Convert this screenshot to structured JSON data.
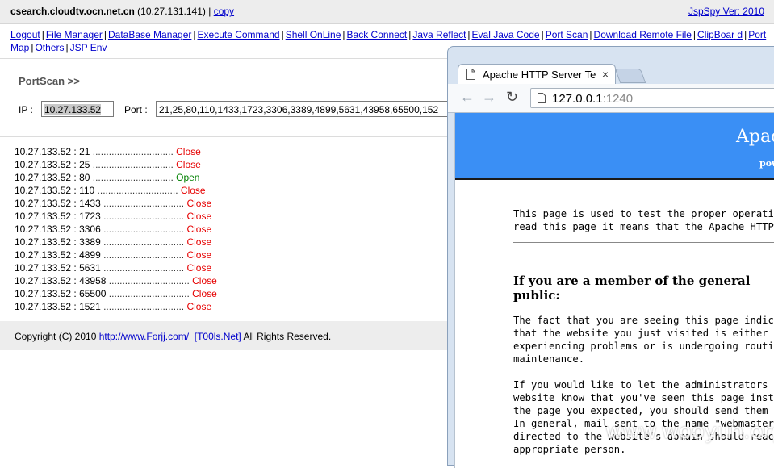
{
  "header": {
    "host_bold": "csearch.cloudtv.ocn.net.cn",
    "host_ip": " (10.27.131.141) | ",
    "copy_link": "copy",
    "version_link": "JspSpy Ver: 2010"
  },
  "menu": [
    "Logout",
    "File Manager",
    "DataBase Manager",
    "Execute Command",
    "Shell OnLine",
    "Back Connect",
    "Java Reflect",
    "Eval Java Code",
    "Port Scan",
    "Download Remote File",
    "ClipBoar d",
    "Port Map",
    "Others",
    "JSP Env"
  ],
  "portscan": {
    "title": "PortScan >>",
    "ip_label": "IP :",
    "ip_value": "10.27.133.52",
    "port_label": "Port :",
    "port_value": "21,25,80,110,1433,1723,3306,3389,4899,5631,43958,65500,152"
  },
  "results": [
    {
      "target": "10.27.133.52 : 21",
      "dots": " ..............................",
      "status": "Close"
    },
    {
      "target": "10.27.133.52 : 25",
      "dots": " ..............................",
      "status": "Close"
    },
    {
      "target": "10.27.133.52 : 80",
      "dots": " ..............................",
      "status": "Open"
    },
    {
      "target": "10.27.133.52 : 110",
      "dots": " ..............................",
      "status": "Close"
    },
    {
      "target": "10.27.133.52 : 1433",
      "dots": " ..............................",
      "status": "Close"
    },
    {
      "target": "10.27.133.52 : 1723",
      "dots": " ..............................",
      "status": "Close"
    },
    {
      "target": "10.27.133.52 : 3306",
      "dots": " ..............................",
      "status": "Close"
    },
    {
      "target": "10.27.133.52 : 3389",
      "dots": " ..............................",
      "status": "Close"
    },
    {
      "target": "10.27.133.52 : 4899",
      "dots": " ..............................",
      "status": "Close"
    },
    {
      "target": "10.27.133.52 : 5631",
      "dots": " ..............................",
      "status": "Close"
    },
    {
      "target": "10.27.133.52 : 43958",
      "dots": " ..............................",
      "status": "Close"
    },
    {
      "target": "10.27.133.52 : 65500",
      "dots": " ..............................",
      "status": "Close"
    },
    {
      "target": "10.27.133.52 : 1521",
      "dots": " ..............................",
      "status": "Close"
    }
  ],
  "footer": {
    "copyright": "Copyright (C) 2010 ",
    "link1": "http://www.Forjj.com/",
    "link2": "[T00ls.Net]",
    "rights": " All Rights Reserved."
  },
  "browser": {
    "tab_title": "Apache HTTP Server Te",
    "tab_close": "×",
    "url_host": "127.0.0.1",
    "url_port": ":1240",
    "banner_title": "Apac",
    "banner_sub": "pow",
    "para1": "This page is used to test the proper operation\nread this page it means that the Apache HTTP se",
    "heading": "If you are a member of the general\npublic:",
    "para2": "The fact that you are seeing this page indicate\nthat the website you just visited is either\nexperiencing problems or is undergoing routine\nmaintenance.",
    "para3": "If you would like to let the administrators of\nwebsite know that you've seen this page instead\nthe page you expected, you should send them e-m\nIn general, mail sent to the name \"webmaster\" a\ndirected to the website's domain should reach t\nappropriate person."
  },
  "watermark": "www.wooyun.org",
  "colors": {
    "link": "#0000cc",
    "close": "#e60000",
    "open": "#008000",
    "banner": "#3a8ff5"
  }
}
